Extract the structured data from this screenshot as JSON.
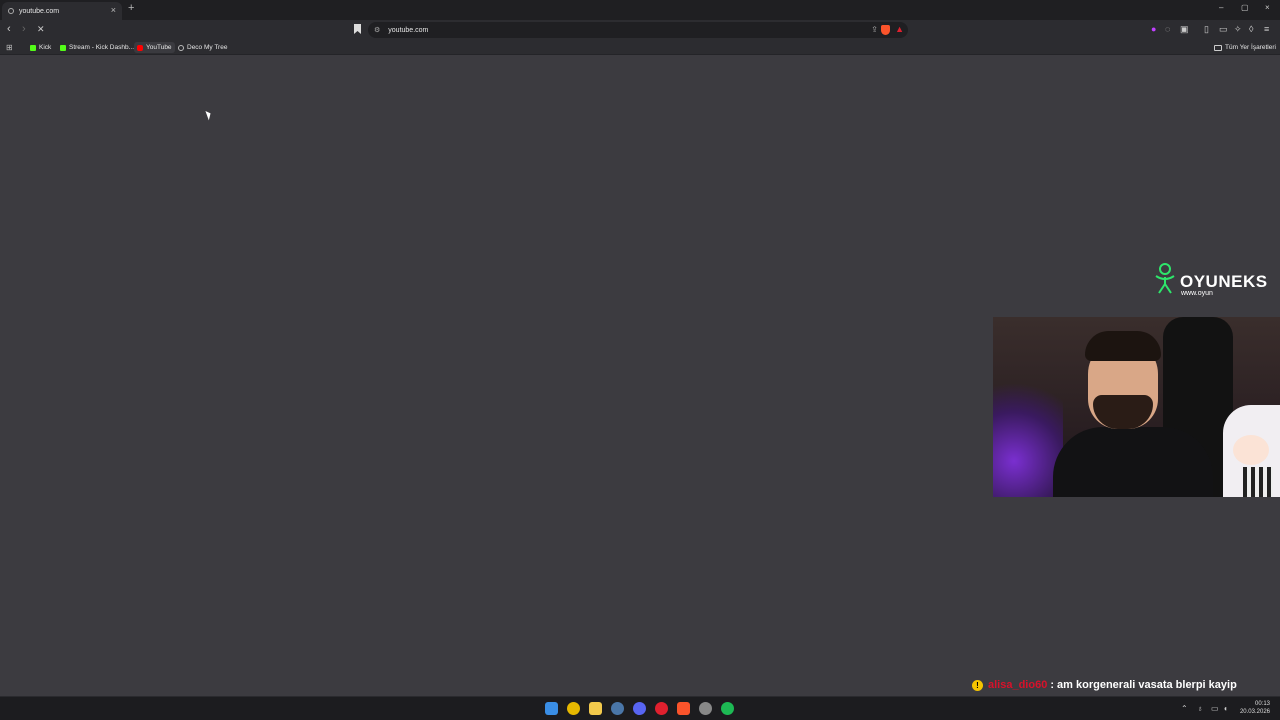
{
  "browser": {
    "tab_title": "youtube.com",
    "tab_close": "×",
    "new_tab": "+",
    "url": "youtube.com",
    "window_controls": [
      "–",
      "▢",
      "×"
    ]
  },
  "bookmarks_bar": {
    "items": [
      {
        "label": "Kick",
        "icon": "kick-icon",
        "color": "#53fc18"
      },
      {
        "label": "Stream - Kick Dashb...",
        "icon": "kick-icon",
        "color": "#53fc18"
      },
      {
        "label": "YouTube",
        "icon": "youtube-icon",
        "color": "#ff0000"
      },
      {
        "label": "Deco My Tree",
        "icon": "globe-icon",
        "color": "#bbbbbb"
      }
    ],
    "all_bookmarks": "Tüm Yer İşaretleri"
  },
  "overlay": {
    "logo_name": "OYUNEKS",
    "logo_url": "www.oyun",
    "chat": {
      "badge": "!",
      "user": "alisa_dio60",
      "message": ": am korgenerali vasata blerpi kayip"
    }
  },
  "taskbar": {
    "icons": [
      {
        "name": "windows-start-icon",
        "color": "#3a8ee6"
      },
      {
        "name": "chrome-icon",
        "color": "#e6b800"
      },
      {
        "name": "file-explorer-icon",
        "color": "#f2c94c"
      },
      {
        "name": "steam-icon",
        "color": "#4a76a8"
      },
      {
        "name": "discord-icon",
        "color": "#5865f2"
      },
      {
        "name": "opera-icon",
        "color": "#e0202e"
      },
      {
        "name": "brave-icon",
        "color": "#fb542b"
      },
      {
        "name": "app-icon",
        "color": "#888888"
      },
      {
        "name": "spotify-icon",
        "color": "#1db954"
      }
    ],
    "time": "00:13",
    "date": "20.03.2026"
  },
  "colors": {
    "content_bg": "#3c3b40",
    "chrome_bg": "#2c2c30",
    "tabbar_bg": "#1f1f22"
  }
}
